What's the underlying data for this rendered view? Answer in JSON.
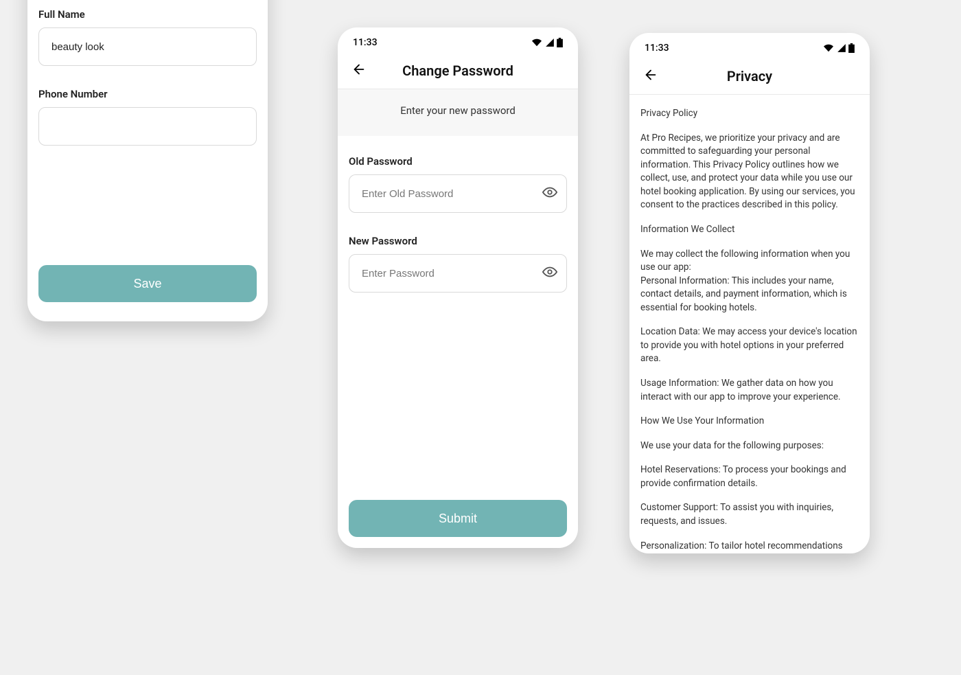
{
  "statusbar": {
    "time": "11:33"
  },
  "phone1": {
    "full_name_label": "Full Name",
    "full_name_value": "beauty look",
    "phone_label": "Phone Number",
    "phone_value": "",
    "save_label": "Save"
  },
  "phone2": {
    "title": "Change Password",
    "instruction": "Enter your new password",
    "old_label": "Old Password",
    "old_placeholder": "Enter Old Password",
    "new_label": "New Password",
    "new_placeholder": "Enter Password",
    "submit_label": "Submit"
  },
  "phone3": {
    "title": "Privacy",
    "p1": "Privacy Policy",
    "p2": "At Pro Recipes, we prioritize your privacy and are committed to safeguarding your personal information. This Privacy Policy outlines how we collect, use, and protect your data while you use our hotel booking application. By using our services, you consent to the practices described in this policy.",
    "p3": "Information We Collect",
    "p4": "We may collect the following information when you use our app:\nPersonal Information: This includes your name, contact details, and payment information, which is essential for booking hotels.",
    "p5": "Location Data: We may access your device's location to provide you with hotel options in your preferred area.",
    "p6": "Usage Information: We gather data on how you interact with our app to improve your experience.",
    "p7": "How We Use Your Information",
    "p8": "We use your data for the following purposes:",
    "p9": "Hotel Reservations: To process your bookings and provide confirmation details.",
    "p10": "Customer Support: To assist you with inquiries, requests, and issues.",
    "p11": "Personalization: To tailor hotel recommendations and"
  }
}
